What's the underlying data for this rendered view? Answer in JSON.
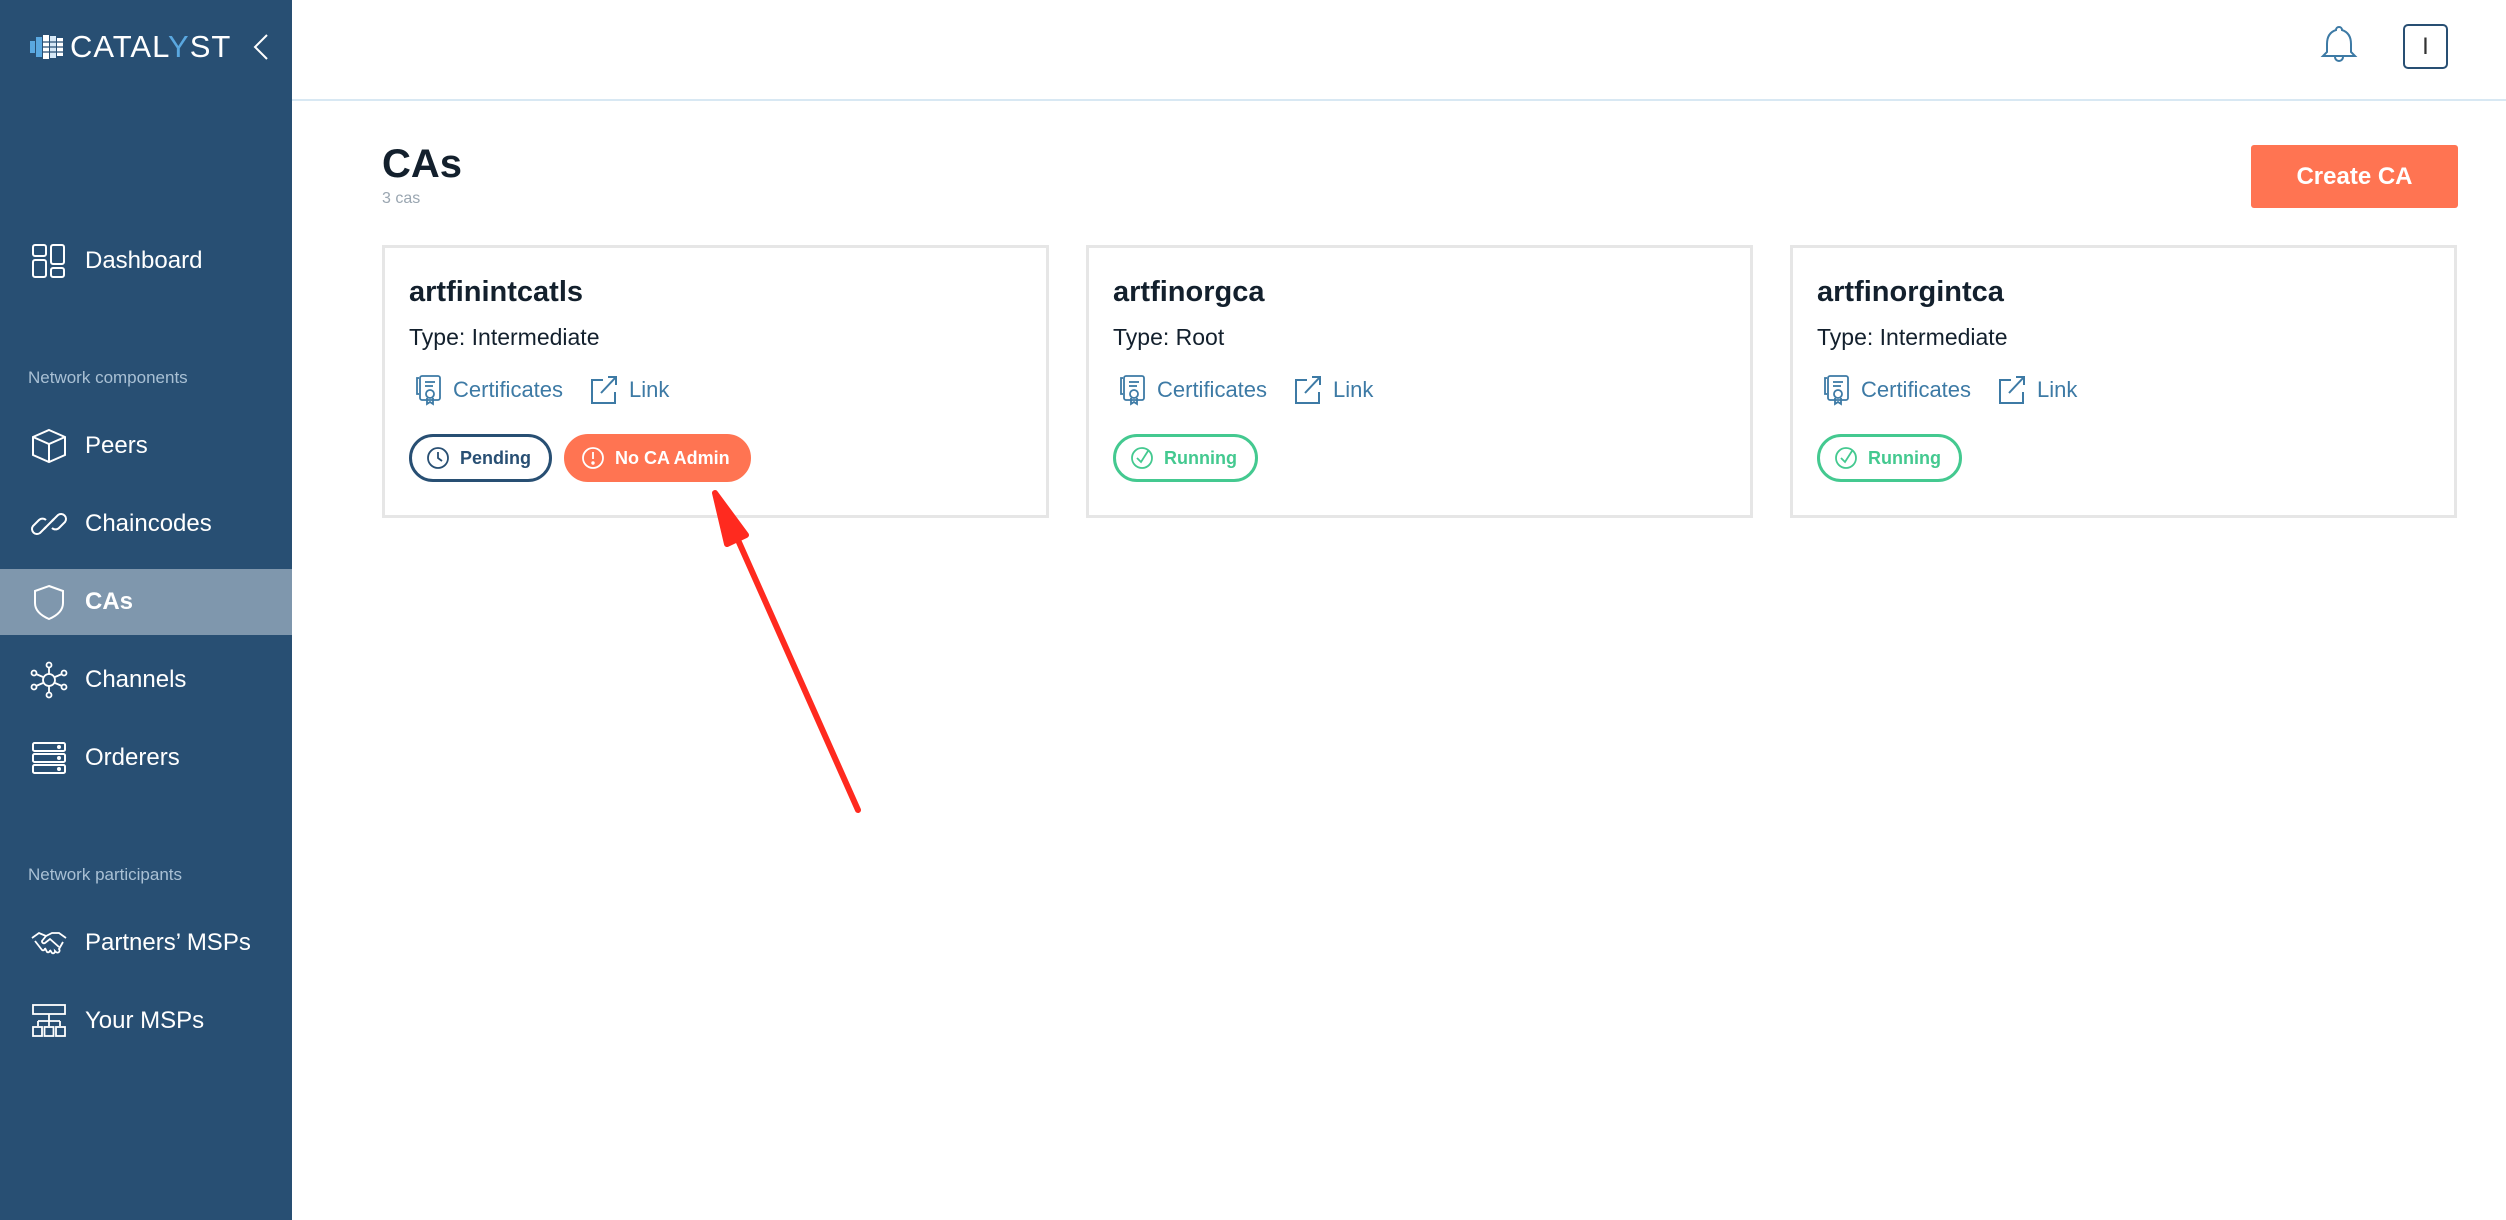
{
  "app": {
    "logo_text_a": "CATAL",
    "logo_text_y": "Y",
    "logo_text_b": "ST",
    "collapse_icon": "chevron-left-icon"
  },
  "sidebar": {
    "items": [
      {
        "label": "Dashboard",
        "icon": "dashboard-icon",
        "active": false
      },
      {
        "label": "Peers",
        "icon": "cube-icon",
        "active": false
      },
      {
        "label": "Chaincodes",
        "icon": "link-chain-icon",
        "active": false
      },
      {
        "label": "CAs",
        "icon": "shield-icon",
        "active": true
      },
      {
        "label": "Channels",
        "icon": "network-hub-icon",
        "active": false
      },
      {
        "label": "Orderers",
        "icon": "server-stack-icon",
        "active": false
      },
      {
        "label": "Partners’ MSPs",
        "icon": "handshake-icon",
        "active": false
      },
      {
        "label": "Your MSPs",
        "icon": "org-chart-icon",
        "active": false
      }
    ],
    "sections": {
      "network_components": "Network components",
      "network_participants": "Network participants"
    }
  },
  "header": {
    "notifications_icon": "bell-icon",
    "user_initial": "I"
  },
  "main": {
    "title": "CAs",
    "subtitle": "3 cas",
    "create_button": "Create CA",
    "cards": [
      {
        "name": "artfinintcatls",
        "type": "Type: Intermediate",
        "certificates_label": "Certificates",
        "link_label": "Link",
        "badges": [
          {
            "label": "Pending",
            "kind": "pending",
            "icon": "clock-icon"
          },
          {
            "label": "No CA Admin",
            "kind": "warning",
            "icon": "exclamation-circle-icon"
          }
        ]
      },
      {
        "name": "artfinorgca",
        "type": "Type: Root",
        "certificates_label": "Certificates",
        "link_label": "Link",
        "badges": [
          {
            "label": "Running",
            "kind": "running",
            "icon": "check-circle-icon"
          }
        ]
      },
      {
        "name": "artfinorgintca",
        "type": "Type: Intermediate",
        "certificates_label": "Certificates",
        "link_label": "Link",
        "badges": [
          {
            "label": "Running",
            "kind": "running",
            "icon": "check-circle-icon"
          }
        ]
      }
    ]
  },
  "colors": {
    "sidebar_bg": "#284f73",
    "sidebar_active": "#7f97ad",
    "accent_orange": "#ff7452",
    "link_blue": "#3d7aa5",
    "running_green": "#44c990",
    "annotation_red": "#ff2a1f"
  }
}
